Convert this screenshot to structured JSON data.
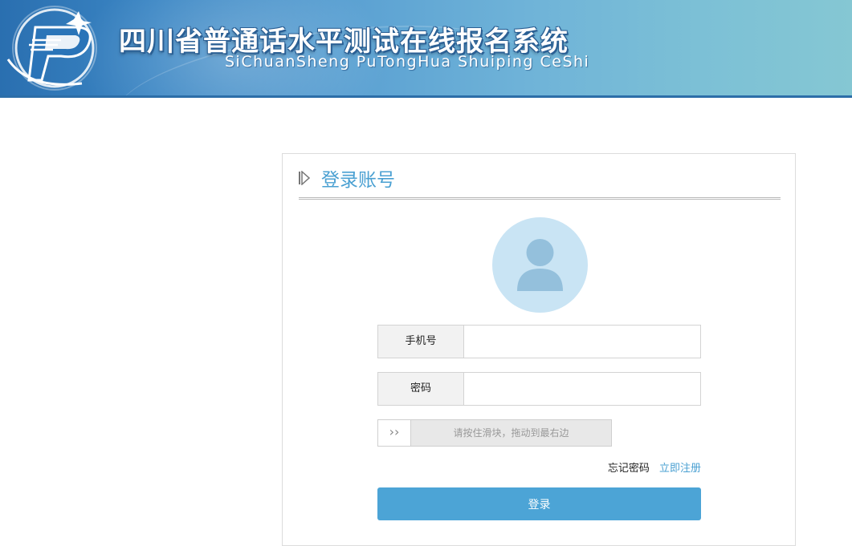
{
  "header": {
    "title": "四川省普通话水平测试在线报名系统",
    "subtitle": "SiChuanSheng PuTongHua Shuiping CeShi",
    "logo_icon": "p-swoosh-logo-icon"
  },
  "login": {
    "heading": "登录账号",
    "heading_icon": "triangle-arrow-icon",
    "avatar_icon": "user-avatar-icon",
    "phone_label": "手机号",
    "phone_value": "",
    "password_label": "密码",
    "password_value": "",
    "slider_handle": "››",
    "slider_hint": "请按住滑块，拖动到最右边",
    "forgot_password": "忘记密码",
    "register": "立即注册",
    "submit": "登录"
  },
  "colors": {
    "accent": "#4ca4d6",
    "header_dark": "#2a6fb0",
    "header_light": "#85c7d3",
    "avatar_bg": "#c9e4f4",
    "avatar_fg": "#94c0dc"
  }
}
